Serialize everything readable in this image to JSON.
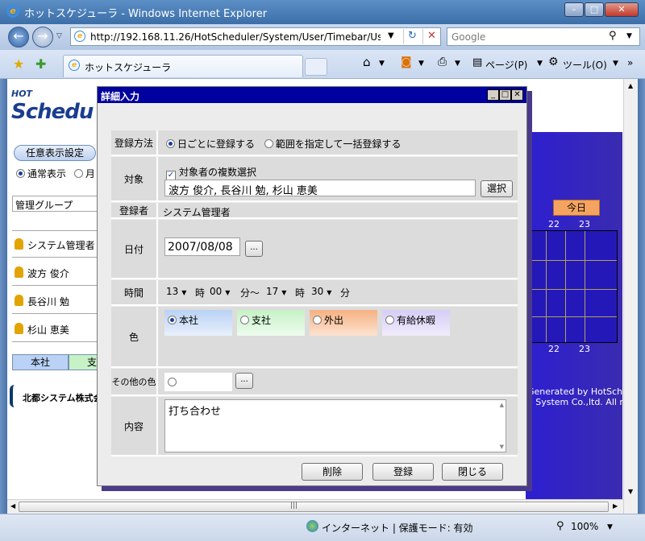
{
  "browser": {
    "title": "ホットスケジューラ - Windows Internet Explorer",
    "url": "http://192.168.11.26/HotScheduler/System/User/Timebar/Us",
    "search_placeholder": "Google",
    "tab_label": "ホットスケジューラ",
    "page_menu": "ページ(P)",
    "tools_menu": "ツール(O)",
    "status_zone": "インターネット | 保護モード: 有効",
    "zoom": "100%"
  },
  "app": {
    "logo_small": "HOT",
    "logo_big": "Schedu",
    "custom_view_button": "任意表示設定",
    "view_normal": "通常表示",
    "view_other": "月",
    "group_label": "管理グループ",
    "members": [
      "システム管理者",
      "波方 俊介",
      "長谷川 勉",
      "杉山 恵美"
    ],
    "legend_honsha": "本社",
    "legend_shisha": "支",
    "company": "北都システム株式会",
    "today_button": "今日",
    "week_days_top": [
      "22",
      "23"
    ],
    "week_days_bottom": [
      "22",
      "23"
    ],
    "footer1": "Generated by HotSchedu",
    "footer2": "o System Co.,ltd. All ri"
  },
  "dialog": {
    "title": "詳細入力",
    "reg_method_label": "登録方法",
    "reg_method_daily": "日ごとに登録する",
    "reg_method_range": "範囲を指定して一括登録する",
    "target_label": "対象",
    "target_multi": "対象者の複数選択",
    "target_value": "波方 俊介, 長谷川 勉, 杉山 恵美",
    "select_button": "選択",
    "registrant_label": "登録者",
    "registrant_value": "システム管理者",
    "date_label": "日付",
    "date_value": "2007/08/08",
    "ellipsis": "...",
    "time_label": "時間",
    "start_hour": "13",
    "hour_unit": "時",
    "start_min": "00",
    "min_range": "分～",
    "end_hour": "17",
    "end_min": "30",
    "min_unit": "分",
    "color_label": "色",
    "colors": [
      {
        "label": "本社",
        "bg": "#b9d2f5",
        "checked": true
      },
      {
        "label": "支社",
        "bg": "#c6f2c6",
        "checked": false
      },
      {
        "label": "外出",
        "bg": "#f6b183",
        "checked": false
      },
      {
        "label": "有給休暇",
        "bg": "#d6cdf5",
        "checked": false
      }
    ],
    "other_color_label": "その他の色",
    "content_label": "内容",
    "content_value": "打ち合わせ",
    "delete_button": "削除",
    "register_button": "登録",
    "close_button": "閉じる"
  }
}
